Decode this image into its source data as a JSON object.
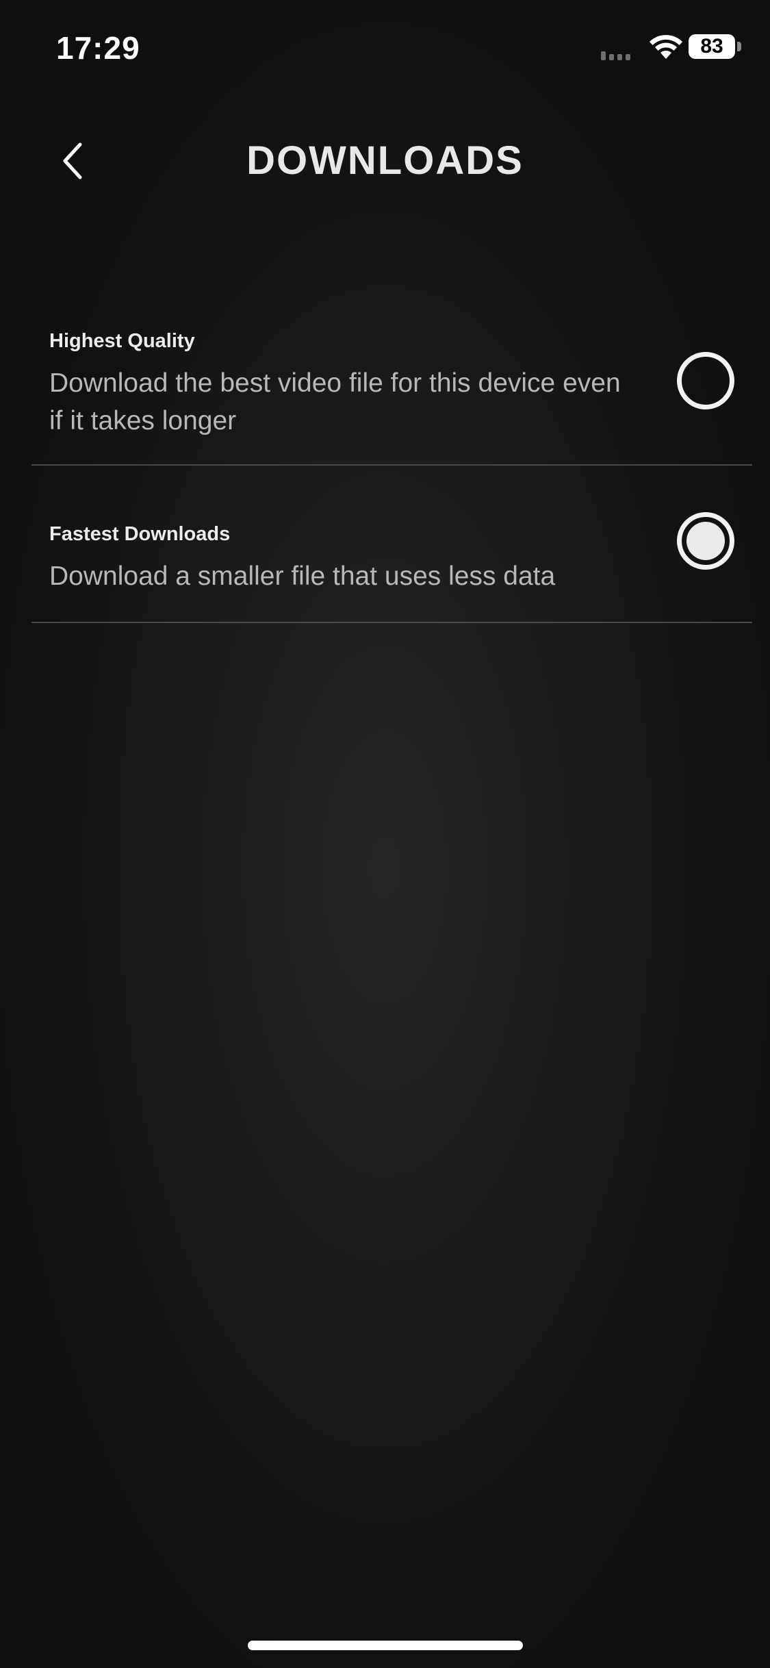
{
  "status_bar": {
    "time": "17:29",
    "battery_level": "83",
    "icons": [
      "signal-icon",
      "wifi-icon",
      "battery-icon"
    ]
  },
  "header": {
    "title": "DOWNLOADS",
    "back_icon": "chevron-left-icon"
  },
  "options": [
    {
      "title": "Highest Quality",
      "description": "Download the best video file for this device even if it takes longer",
      "selected": false
    },
    {
      "title": "Fastest Downloads",
      "description": "Download a smaller file that uses less data",
      "selected": true
    }
  ],
  "colors": {
    "background": "#121314",
    "title_text": "#e8e8e8",
    "description_text": "#b8b8b8",
    "divider": "#4a4a4c",
    "radio": "#f2f2f2"
  }
}
